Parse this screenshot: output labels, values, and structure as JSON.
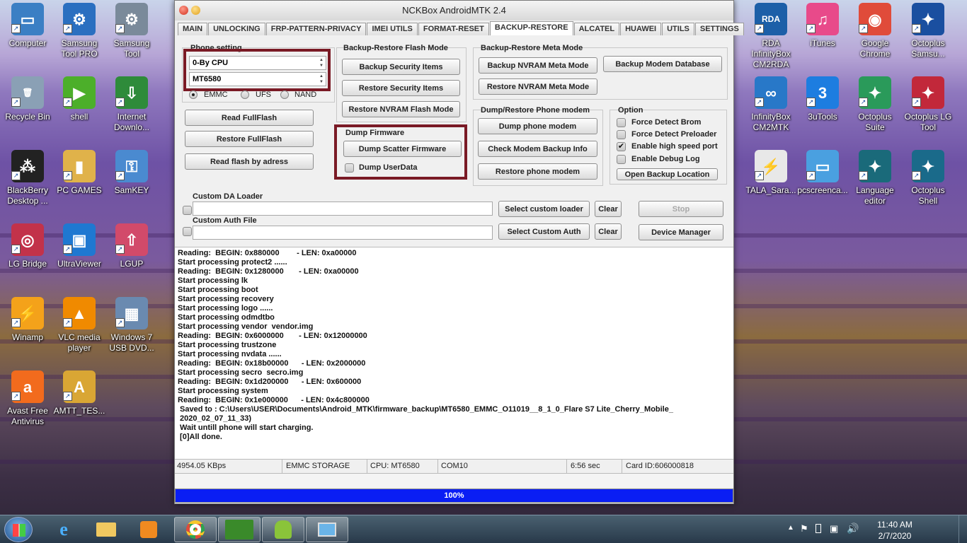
{
  "window": {
    "title": "NCKBox AndroidMTK 2.4"
  },
  "tabs": [
    "MAIN",
    "UNLOCKING",
    "FRP-PATTERN-PRIVACY",
    "IMEI UTILS",
    "FORMAT-RESET",
    "BACKUP-RESTORE",
    "ALCATEL",
    "HUAWEI",
    "UTILS",
    "SETTINGS"
  ],
  "phone_setting": {
    "label": "Phone setting",
    "cpu_combo": "0-By CPU",
    "model_combo": "MT6580",
    "storage": [
      "EMMC",
      "UFS",
      "NAND"
    ]
  },
  "flash_buttons": {
    "read_fullflash": "Read FullFlash",
    "restore_fullflash": "Restore FullFlash",
    "read_by_address": "Read flash by adress"
  },
  "flash_mode": {
    "label": "Backup-Restore Flash Mode",
    "backup_security": "Backup Security Items",
    "restore_security": "Restore Security Items",
    "restore_nvram_flash": "Restore NVRAM Flash Mode"
  },
  "dump_firmware": {
    "label": "Dump  Firmware",
    "scatter": "Dump Scatter Firmware",
    "userdata": "Dump UserData"
  },
  "meta_mode": {
    "label": "Backup-Restore Meta Mode",
    "backup_nvram": "Backup NVRAM Meta Mode",
    "restore_nvram": "Restore NVRAM Meta Mode",
    "backup_modem_db": "Backup Modem Database"
  },
  "modem": {
    "label": "Dump/Restore Phone modem",
    "dump": "Dump phone modem",
    "check": "Check Modem Backup Info",
    "restore": "Restore phone modem"
  },
  "options": {
    "label": "Option",
    "force_brom": "Force Detect Brom",
    "force_preloader": "Force Detect Preloader",
    "high_speed": "Enable high speed port",
    "debug_log": "Enable Debug Log",
    "high_speed_check": "✔",
    "open_backup": "Open Backup Location"
  },
  "custom": {
    "da_label": "Custom DA Loader",
    "auth_label": "Custom Auth File",
    "select_loader": "Select custom loader",
    "select_auth": "Select Custom Auth",
    "clear": "Clear",
    "stop": "Stop",
    "device_manager": "Device Manager"
  },
  "log": [
    "Reading:  BEGIN: 0x880000        - LEN: 0xa00000",
    "Start processing protect2 ......",
    "Reading:  BEGIN: 0x1280000       - LEN: 0xa00000",
    "Start processing lk",
    "Start processing boot",
    "Start processing recovery",
    "Start processing logo ......",
    "Start processing odmdtbo",
    "Start processing vendor  vendor.img",
    "Reading:  BEGIN: 0x6000000       - LEN: 0x12000000",
    "Start processing trustzone",
    "Start processing nvdata ......",
    "Reading:  BEGIN: 0x18b00000      - LEN: 0x2000000",
    "Start processing secro  secro.img",
    "Reading:  BEGIN: 0x1d200000      - LEN: 0x600000",
    "Start processing system",
    "Reading:  BEGIN: 0x1e000000      - LEN: 0x4c800000",
    " Saved to : C:\\Users\\USER\\Documents\\Android_MTK\\firmware_backup\\MT6580_EMMC_O11019__8_1_0_Flare S7 Lite_Cherry_Mobile_",
    " 2020_02_07_11_33)",
    " Wait untill phone will start charging.",
    " [0]All done."
  ],
  "status": {
    "speed": "4954.05 KBps",
    "storage": "EMMC STORAGE",
    "cpu": "CPU: MT6580",
    "port": "COM10",
    "time": "6:56 sec",
    "card": "Card ID:606000818"
  },
  "progress": {
    "value": 100,
    "label": "100%"
  },
  "desktop_icons": [
    {
      "label": "Computer",
      "color": "#3b7fc4",
      "glyph": "▭"
    },
    {
      "label": "Samsung Tool PRO",
      "color": "#2a6fc0",
      "glyph": "⚙"
    },
    {
      "label": "Samsung Tool",
      "color": "#7a8a9a",
      "glyph": "⚙"
    },
    {
      "label": "Recycle Bin",
      "color": "#8aa0b5",
      "glyph": "🗑"
    },
    {
      "label": "shell",
      "color": "#4caf2a",
      "glyph": "▶"
    },
    {
      "label": "Internet Downlo...",
      "color": "#2e8b3a",
      "glyph": "⇩"
    },
    {
      "label": "BlackBerry Desktop ...",
      "color": "#222",
      "glyph": "⁂"
    },
    {
      "label": "PC GAMES",
      "color": "#e0b24a",
      "glyph": "▮"
    },
    {
      "label": "SamKEY",
      "color": "#4a8ad0",
      "glyph": "⚿"
    },
    {
      "label": "LG Bridge",
      "color": "#c2324a",
      "glyph": "◎"
    },
    {
      "label": "UltraViewer",
      "color": "#1f78d1",
      "glyph": "▣"
    },
    {
      "label": "LGUP",
      "color": "#d24a6a",
      "glyph": "⇧"
    },
    {
      "label": "Winamp",
      "color": "#f4a21a",
      "glyph": "⚡"
    },
    {
      "label": "VLC media player",
      "color": "#f08a00",
      "glyph": "▲"
    },
    {
      "label": "Windows 7 USB DVD...",
      "color": "#6a8ab0",
      "glyph": "▦"
    },
    {
      "label": "Avast Free Antivirus",
      "color": "#f26b1d",
      "glyph": "a"
    },
    {
      "label": "AMTT_TES...",
      "color": "#d9a634",
      "glyph": "A"
    },
    {
      "label": "RDA InfinityBox CM2RDA",
      "color": "#1c5fa8",
      "glyph": "RDA"
    },
    {
      "label": "iTunes",
      "color": "#e84a8a",
      "glyph": "♫"
    },
    {
      "label": "Google Chrome",
      "color": "#e04b3a",
      "glyph": "◉"
    },
    {
      "label": "Octoplus Samsu...",
      "color": "#1a4fa0",
      "glyph": "✦"
    },
    {
      "label": "InfinityBox CM2MTK",
      "color": "#2878c8",
      "glyph": "∞"
    },
    {
      "label": "3uTools",
      "color": "#1d7de0",
      "glyph": "3"
    },
    {
      "label": "Octoplus Suite",
      "color": "#2a9a5a",
      "glyph": "✦"
    },
    {
      "label": "Octoplus LG Tool",
      "color": "#c2283a",
      "glyph": "✦"
    },
    {
      "label": "TALA_Sara...",
      "color": "#e8e8e8",
      "glyph": "⚡"
    },
    {
      "label": "pcscreenca...",
      "color": "#4aa0e0",
      "glyph": "▭"
    },
    {
      "label": "Language editor",
      "color": "#1a6a7a",
      "glyph": "✦"
    },
    {
      "label": "Octoplus Shell",
      "color": "#1a6a8a",
      "glyph": "✦"
    }
  ],
  "taskbar": {
    "time": "11:40 AM",
    "date": "2/7/2020"
  }
}
